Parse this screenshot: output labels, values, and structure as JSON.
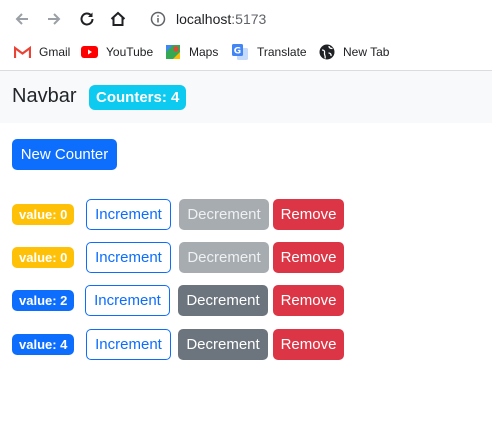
{
  "browser": {
    "url_host": "localhost",
    "url_port": ":5173",
    "bookmarks": [
      {
        "label": "Gmail",
        "icon": "gmail-icon"
      },
      {
        "label": "YouTube",
        "icon": "youtube-icon"
      },
      {
        "label": "Maps",
        "icon": "maps-icon"
      },
      {
        "label": "Translate",
        "icon": "translate-icon"
      },
      {
        "label": "New Tab",
        "icon": "globe-icon"
      }
    ]
  },
  "navbar": {
    "brand": "Navbar",
    "counter_badge": "Counters: 4"
  },
  "main": {
    "new_counter_label": "New Counter"
  },
  "counters": [
    {
      "value_label": "value: 0",
      "badge_color": "warning",
      "increment": "Increment",
      "decrement": "Decrement",
      "decrement_disabled": true,
      "remove": "Remove"
    },
    {
      "value_label": "value: 0",
      "badge_color": "warning",
      "increment": "Increment",
      "decrement": "Decrement",
      "decrement_disabled": true,
      "remove": "Remove"
    },
    {
      "value_label": "value: 2",
      "badge_color": "primary",
      "increment": "Increment",
      "decrement": "Decrement",
      "decrement_disabled": false,
      "remove": "Remove"
    },
    {
      "value_label": "value: 4",
      "badge_color": "primary",
      "increment": "Increment",
      "decrement": "Decrement",
      "decrement_disabled": false,
      "remove": "Remove"
    }
  ],
  "colors": {
    "primary": "#0d6efd",
    "warning": "#ffc107",
    "info": "#0dcaf0",
    "secondary": "#6c757d",
    "danger": "#dc3545"
  }
}
